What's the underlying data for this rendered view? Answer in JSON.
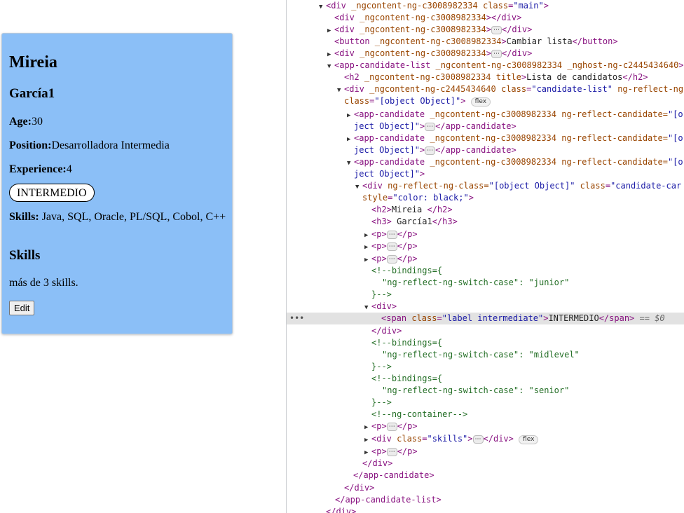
{
  "card": {
    "first_name": "Mireia",
    "last_name": "García1",
    "age_label": "Age:",
    "age_value": "30",
    "position_label": "Position:",
    "position_value": "Desarrolladora Intermedia",
    "experience_label": "Experience:",
    "experience_value": "4",
    "level_badge": "INTERMEDIO",
    "skills_label": "Skills:",
    "skills_value": " Java, SQL, Oracle, PL/SQL, Cobol, C++",
    "skills_heading": "Skills",
    "skills_summary": "más de 3 skills.",
    "edit_button": "Edit",
    "background_color": "#8bbff7"
  },
  "devtools": {
    "ngcontent_main": "_ngcontent-ng-c3008982334",
    "class_main": "main",
    "button_text": "Cambiar lista",
    "list_tag": "app-candidate-list",
    "list_attrs": "_ngcontent-ng-c3008982334 _nghost-ng-c2445434640",
    "h2_attr": "_ngcontent-ng-c3008982334 title",
    "h2_text": "Lista de candidatos",
    "inner_ng": "_ngcontent-ng-c2445434640",
    "inner_class": "candidate-list",
    "inner_reflect": "ng-reflect-ng",
    "class_obj": "[object Object]",
    "flex_pill": "flex",
    "cand_tag": "app-candidate",
    "cand_attrs": "_ngcontent-ng-c3008982334 ng-reflect-candidate=",
    "cand_val_start": "\"[o",
    "cand_val_end": "ject Object]\"",
    "div_reflect": "ng-reflect-ng-class=",
    "div_reflect_val": "\"[object Object]\"",
    "div_class_val": "\"candidate-car",
    "style_val": "\"color: black;\"",
    "h2_name": "Mireia ",
    "h3_name": " García1",
    "bindings_open": "<!--bindings={",
    "switch_key": "\"ng-reflect-ng-switch-case\": ",
    "case_junior": "\"junior\"",
    "case_midlevel": "\"midlevel\"",
    "case_senior": "\"senior\"",
    "bindings_close": "}-->",
    "span_class_val": "\"label intermediate\"",
    "span_text": "INTERMEDIO",
    "selected_marker": "== $0",
    "container_comment": "<!--ng-container-->",
    "skills_class_val": "\"skills\"",
    "ellipsis": "⋯",
    "gutter_dots": "•••"
  }
}
